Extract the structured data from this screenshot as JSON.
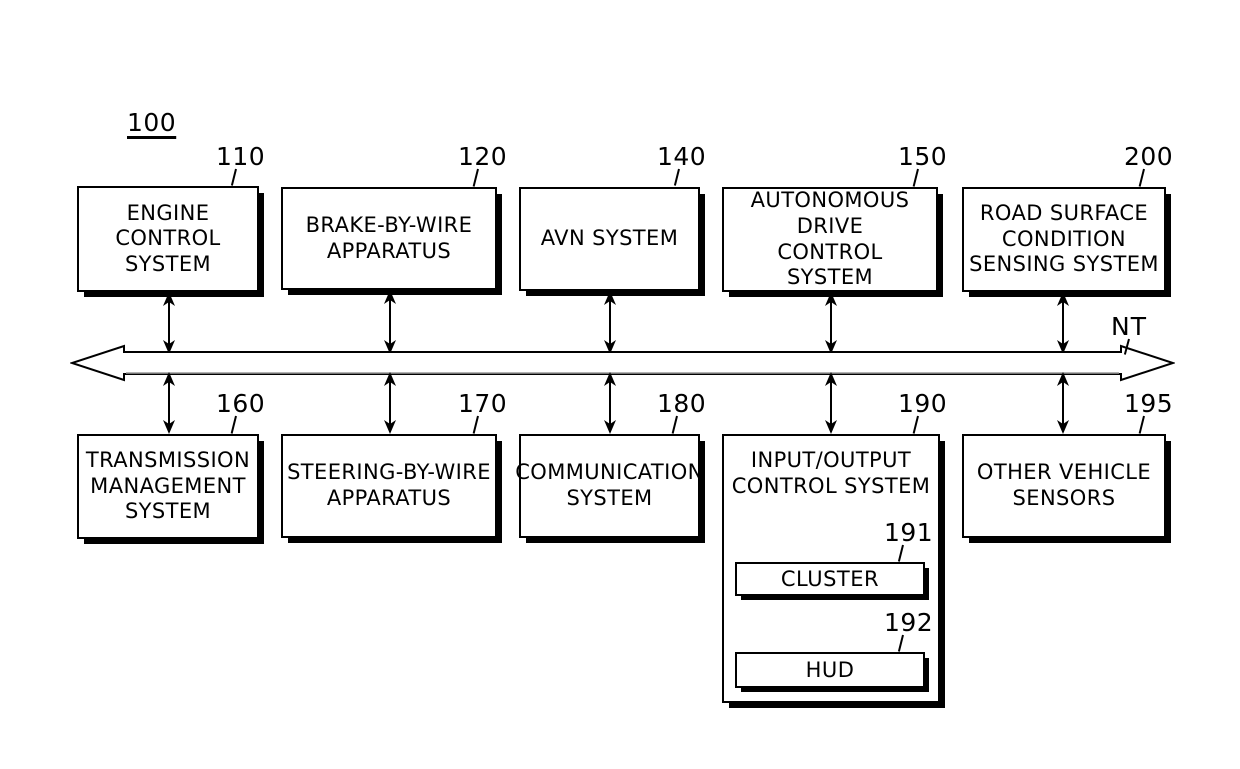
{
  "figure": {
    "system_id": "100",
    "network_label": "NT",
    "background": "#ffffff",
    "stroke": "#000000"
  },
  "top_row": [
    {
      "ref": "110",
      "label": "ENGINE\nCONTROL\nSYSTEM"
    },
    {
      "ref": "120",
      "label": "BRAKE-BY-WIRE\nAPPARATUS"
    },
    {
      "ref": "140",
      "label": "AVN SYSTEM"
    },
    {
      "ref": "150",
      "label": "AUTONOMOUS DRIVE\nCONTROL\nSYSTEM"
    },
    {
      "ref": "200",
      "label": "ROAD SURFACE\nCONDITION\nSENSING SYSTEM"
    }
  ],
  "bottom_row": [
    {
      "ref": "160",
      "label": "TRANSMISSION\nMANAGEMENT\nSYSTEM"
    },
    {
      "ref": "170",
      "label": "STEERING-BY-WIRE\nAPPARATUS"
    },
    {
      "ref": "180",
      "label": "COMMUNICATION\nSYSTEM"
    },
    {
      "ref": "190",
      "label": "INPUT/OUTPUT\nCONTROL SYSTEM"
    },
    {
      "ref": "195",
      "label": "OTHER VEHICLE\nSENSORS"
    }
  ],
  "io_subsystems": [
    {
      "ref": "191",
      "label": "CLUSTER"
    },
    {
      "ref": "192",
      "label": "HUD"
    }
  ]
}
